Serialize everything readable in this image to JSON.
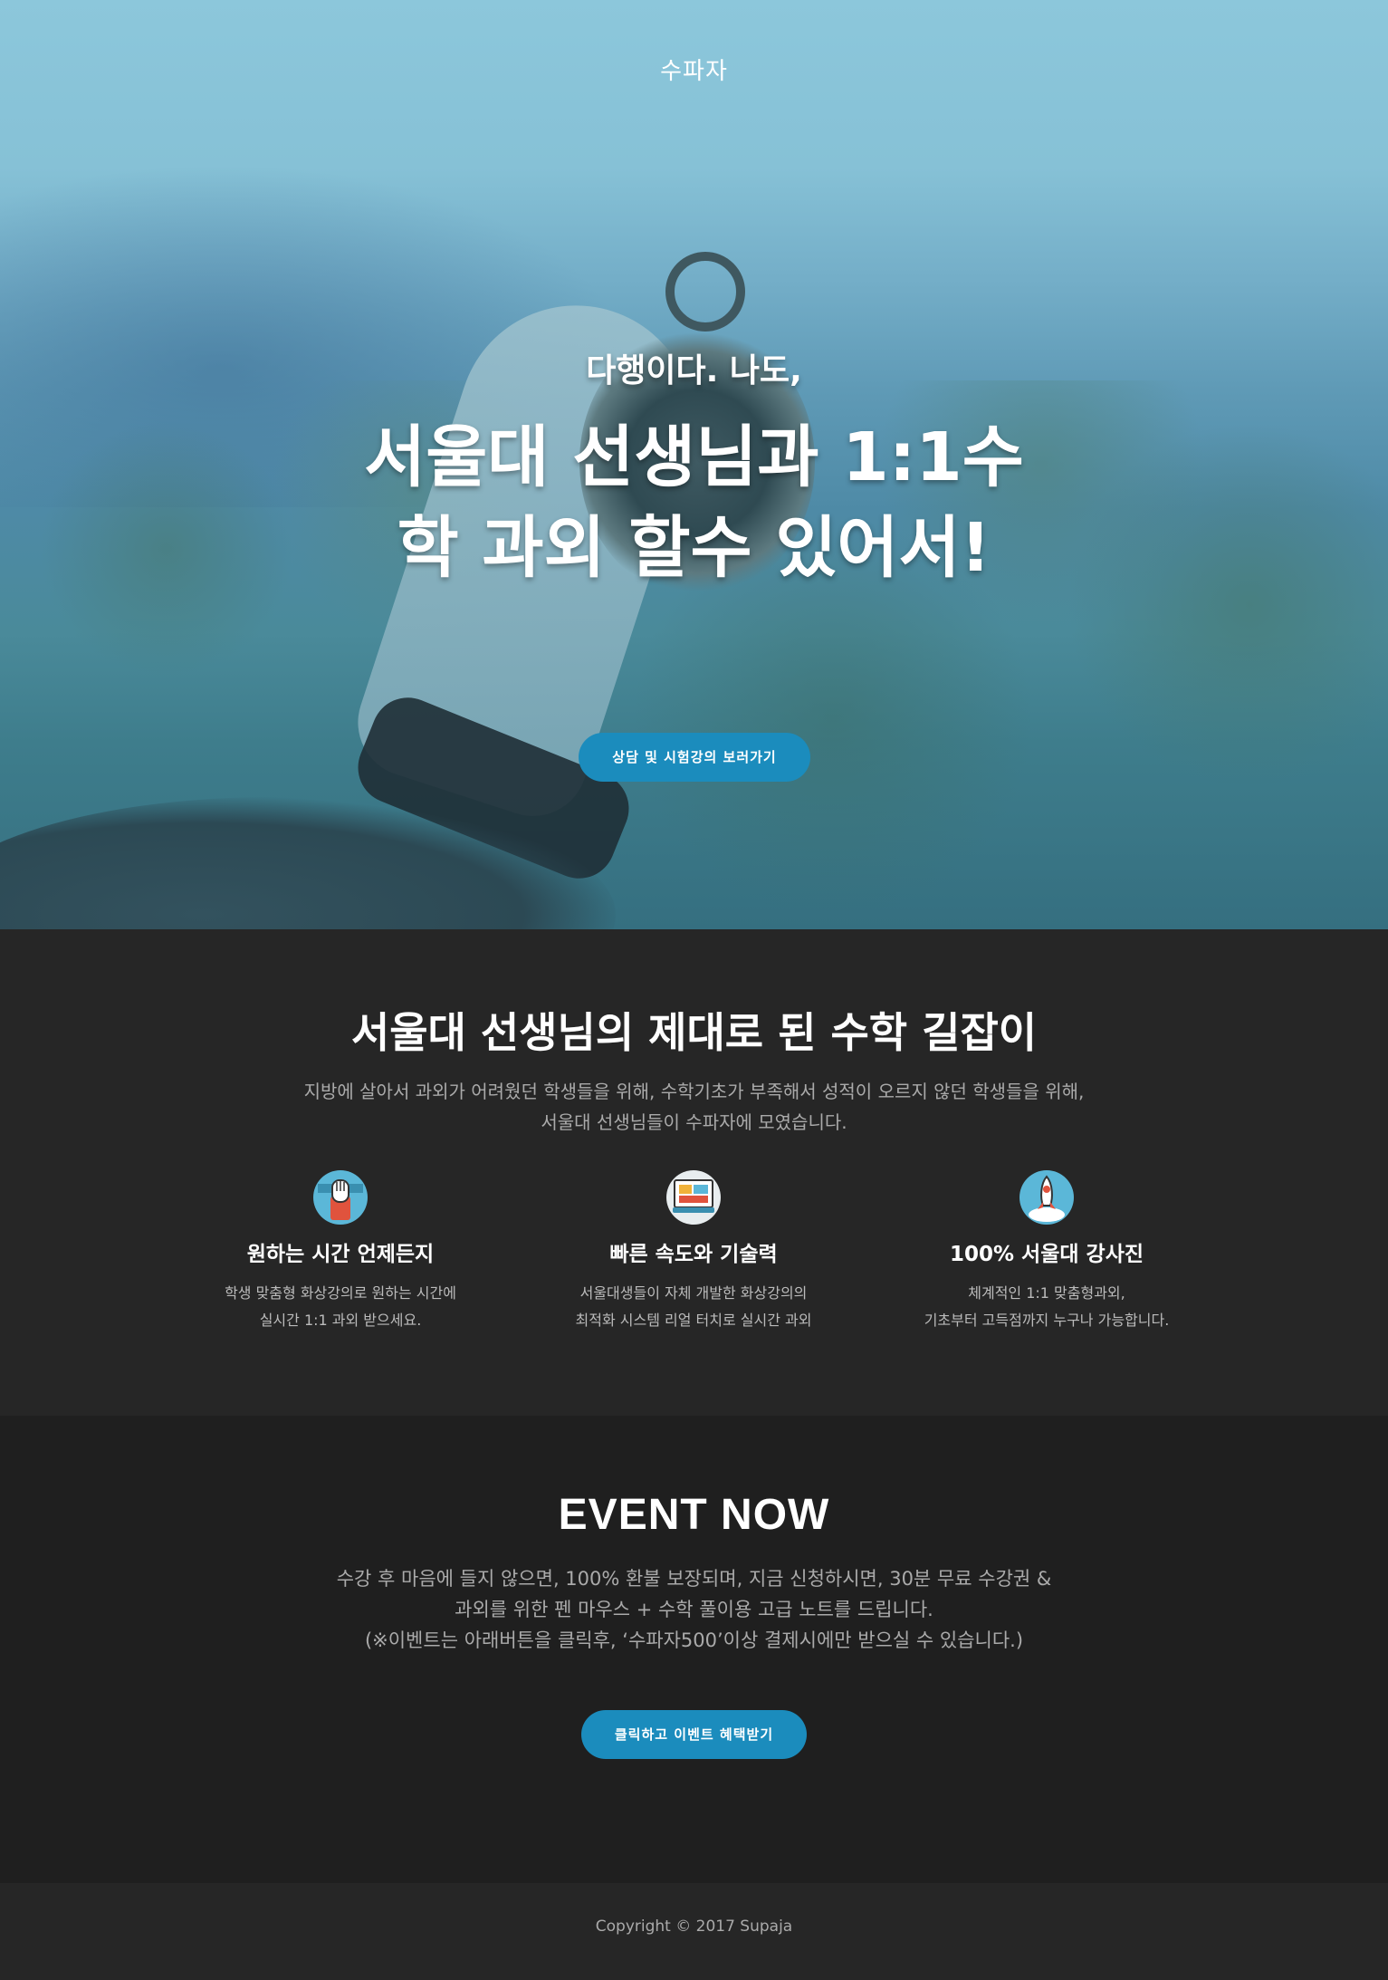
{
  "brand": {
    "logo_text": "수파자"
  },
  "hero": {
    "subtitle": "다행이다. 나도,",
    "title": "서울대 선생님과 1:1수학 과외 할수 있어서!",
    "cta_label": "상담 및 시험강의 보러가기"
  },
  "features": {
    "title": "서울대 선생님의 제대로 된 수학 길잡이",
    "description_line1": "지방에 살아서 과외가 어려웠던 학생들을 위해, 수학기초가 부족해서 성적이 오르지 않던 학생들을 위해,",
    "description_line2": "서울대 선생님들이 수파자에 모였습니다.",
    "items": [
      {
        "icon": "hand-icon",
        "name": "원하는 시간 언제든지",
        "line1": "학생 맞춤형 화상강의로 원하는 시간에",
        "line2": "실시간 1:1 과외 받으세요."
      },
      {
        "icon": "computer-icon",
        "name": "빠른 속도와 기술력",
        "line1": "서울대생들이 자체 개발한 화상강의의",
        "line2": "최적화 시스템 리얼 터치로 실시간 과외"
      },
      {
        "icon": "rocket-icon",
        "name": "100% 서울대 강사진",
        "line1": "체계적인 1:1 맞춤형과외,",
        "line2": "기초부터 고득점까지 누구나 가능합니다."
      }
    ]
  },
  "event": {
    "title": "EVENT NOW",
    "line1": "수강 후 마음에 들지 않으면, 100% 환불 보장되며, 지금 신청하시면, 30분 무료 수강권 &",
    "line2": "과외를 위한 펜 마우스 + 수학 풀이용 고급 노트를 드립니다.",
    "line3": "(※이벤트는 아래버튼을 클릭후, ‘수파자500’이상 결제시에만 받으실 수 있습니다.)",
    "cta_label": "클릭하고 이벤트 혜택받기"
  },
  "footer": {
    "copyright": "Copyright © 2017 Supaja"
  },
  "colors": {
    "accent": "#1b8cbd",
    "dark_bg": "#262626",
    "event_bg": "#1f1f1f"
  }
}
